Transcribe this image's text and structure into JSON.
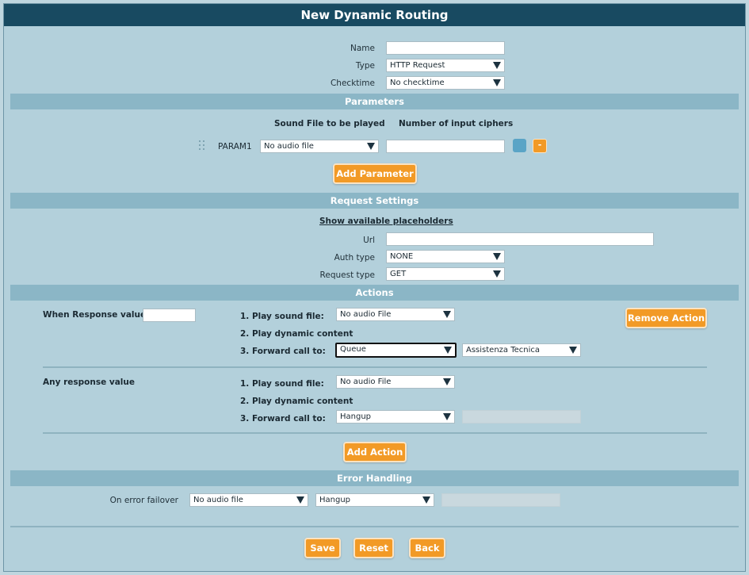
{
  "window": {
    "title": "New Dynamic Routing"
  },
  "general": {
    "name_label": "Name",
    "name_value": "",
    "type_label": "Type",
    "type_value": "HTTP Request",
    "checktime_label": "Checktime",
    "checktime_value": "No checktime"
  },
  "parameters": {
    "section_title": "Parameters",
    "col_sound": "Sound File to be played",
    "col_ciphers": "Number of input ciphers",
    "rows": [
      {
        "name": "PARAM1",
        "sound": "No audio file",
        "ciphers": "",
        "remove_label": "-"
      }
    ],
    "add_label": "Add Parameter"
  },
  "request": {
    "section_title": "Request Settings",
    "placeholders_link": "Show available placeholders",
    "url_label": "Url",
    "url_value": "",
    "auth_label": "Auth type",
    "auth_value": "NONE",
    "reqtype_label": "Request type",
    "reqtype_value": "GET"
  },
  "actions": {
    "section_title": "Actions",
    "action1": {
      "condition_label": "When Response value is",
      "condition_value": "",
      "play_label": "1. Play sound file:",
      "play_value": "No audio File",
      "dynamic_label": "2. Play dynamic content",
      "forward_label": "3. Forward call to:",
      "forward_value": "Queue",
      "forward_target": "Assistenza Tecnica",
      "remove_label": "Remove Action"
    },
    "action2": {
      "condition_label": "Any response value",
      "play_label": "1. Play sound file:",
      "play_value": "No audio File",
      "dynamic_label": "2. Play dynamic content",
      "forward_label": "3. Forward call to:",
      "forward_value": "Hangup",
      "forward_target": ""
    },
    "add_label": "Add Action"
  },
  "error": {
    "section_title": "Error Handling",
    "failover_label": "On error failover",
    "audio_value": "No audio file",
    "action_value": "Hangup",
    "target_value": ""
  },
  "footer": {
    "save_label": "Save",
    "reset_label": "Reset",
    "back_label": "Back"
  },
  "colors": {
    "header": "#184a61",
    "band": "#8bb6c6",
    "panel": "#b3d0db",
    "accent": "#f29a26"
  }
}
